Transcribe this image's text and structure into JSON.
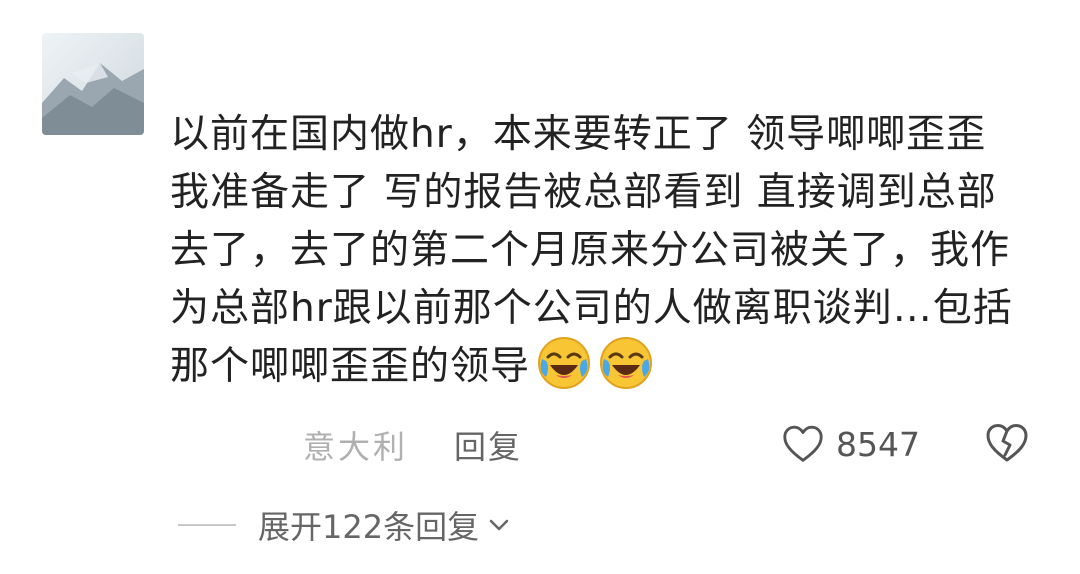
{
  "comment": {
    "lines": [
      "以前在国内做hr，本来要转正了 领导唧唧歪歪",
      "我准备走了 写的报告被总部看到 直接调到总部",
      "去了，去了的第二个月原来分公司被关了，我作",
      "为总部hr跟以前那个公司的人做离职谈判…包括",
      "那个唧唧歪歪的领导"
    ],
    "emoji": [
      "laughing-crying-emoji",
      "laughing-crying-emoji"
    ]
  },
  "meta": {
    "location": "意大利",
    "reply_label": "回复",
    "like_count": "8547"
  },
  "replies": {
    "expand_label": "展开122条回复"
  },
  "icons": {
    "like": "heart-outline-icon",
    "dislike": "broken-heart-icon",
    "expand": "chevron-down-icon"
  },
  "colors": {
    "text": "#222222",
    "muted": "#b0b0b0",
    "secondary": "#666666"
  }
}
